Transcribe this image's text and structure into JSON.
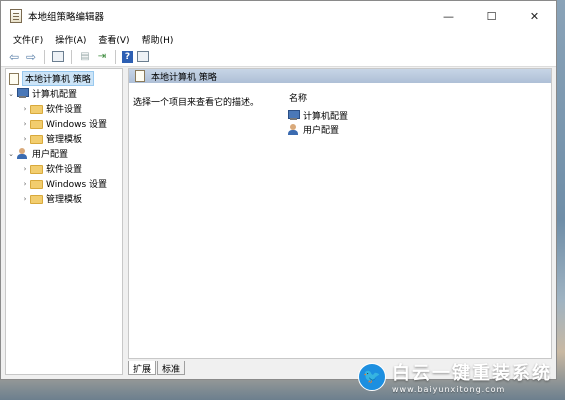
{
  "window": {
    "title": "本地组策略编辑器",
    "controls": {
      "minimize": "—",
      "maximize": "☐",
      "close": "✕"
    }
  },
  "menu": [
    "文件(F)",
    "操作(A)",
    "查看(V)",
    "帮助(H)"
  ],
  "toolbar": {
    "icons": [
      "back-arrow-icon",
      "forward-arrow-icon",
      "console-tree-icon",
      "properties-icon",
      "export-list-icon",
      "help-icon",
      "view-icon"
    ]
  },
  "tree": {
    "root": "本地计算机 策略",
    "computer": {
      "label": "计算机配置",
      "children": [
        "软件设置",
        "Windows 设置",
        "管理模板"
      ]
    },
    "user": {
      "label": "用户配置",
      "children": [
        "软件设置",
        "Windows 设置",
        "管理模板"
      ]
    }
  },
  "panel": {
    "header": "本地计算机 策略",
    "description": "选择一个项目来查看它的描述。",
    "column_name": "名称",
    "items": [
      "计算机配置",
      "用户配置"
    ]
  },
  "tabs": [
    "扩展",
    "标准"
  ],
  "watermark": {
    "title": "白云一键重装系统",
    "url": "www.baiyunxitong.com"
  }
}
